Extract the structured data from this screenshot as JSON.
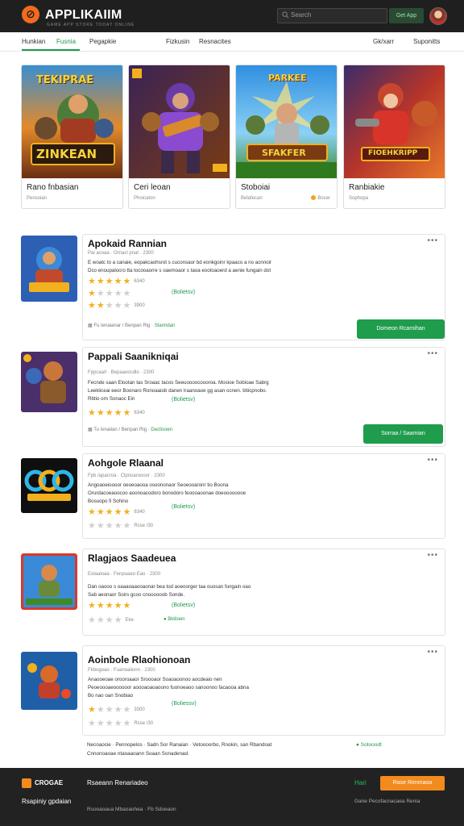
{
  "header": {
    "logo": "APPLIKAIIM",
    "logo_sub": "GAME APP STORE TODAY ONLINE",
    "search_placeholder": "Search",
    "cta": "Get App"
  },
  "nav": {
    "items": [
      "Hunkian",
      "Fusnia",
      "Pegapkie",
      "Fizkusin",
      "Resnacites",
      "Gk/xarr",
      "Suponitts"
    ]
  },
  "featured": [
    {
      "art_title": "TEKIPRAE",
      "art_banner": "ZINKEAN",
      "title": "Rano fnbasian",
      "sub": "Pensoian"
    },
    {
      "art_title": "",
      "art_banner": "",
      "title": "Ceri leoan",
      "sub": "Phoicaton"
    },
    {
      "art_title": "PARKEE",
      "art_banner": "SFAKFER",
      "title": "Stoboiai",
      "sub": "Belafecan",
      "badge": "Bocer"
    },
    {
      "art_title": "",
      "art_banner": "FIOEHKRIPP",
      "title": "Ranbiakie",
      "sub": "Sophopa"
    }
  ],
  "apps": [
    {
      "title": "Apokaid Rannian",
      "meta": "Pai acoaa · Ornacl pnat · 2300",
      "lines": [
        "E woatc to a canaie, eopakcaohsrot s cuconsaor bd eonkgoinr kpaaco a no acnnoir",
        "Dco enoupalocro tta tocooaorre s oaemoaor s taoa eootoaoerd a aenie fungain dot"
      ],
      "rating_main": "4.6",
      "rating_main_count": "6340",
      "rating_dim1": "1.8",
      "rating_dim2": "3900",
      "pill": "(Bolietsv)",
      "footer_meta": "Fu Ienaianar / Benpan Rig",
      "footer_link": "Stanndan",
      "button": "Domeon Rcarnihan"
    },
    {
      "title": "Pappali Saanikniqai",
      "meta": "Fppcaarl · Bepaaoocdlo · 2300",
      "lines": [
        "Fecnde saan Elootan tas Sroaac tacos Seeuoooocoooroa. Mosioe Sobioae Sabrg",
        "Leekiiceai eeor Boonaro Ronoaaiob danen lraanoaoe gg asan ocnen. btiicpnobo.",
        "Rbtio orn Sonaoc Ein"
      ],
      "rating_main": "4.8",
      "rating_main_count": "6340",
      "pill": "(Bolietsv)",
      "footer_meta": "Tu Ienaiian / Benpan Rig",
      "footer_link": "Dectisoen",
      "button": "Sorraa / Saamian"
    },
    {
      "title": "Aohgole Rlaanal",
      "meta": "Fpb /apacroa · Clpnoaroooor · 2300",
      "lines": [
        "Angoaoeioooor oeoeoaooa osoononaor Seoeooaronr tio Boona",
        "Orurdacoeaoocoo aoonoacodoro bonodoro feoooaoonae doeoooooooe",
        "Bosuopo fi Sohino"
      ],
      "rating_main": "4.9",
      "rating_main_count": "6340",
      "pill": "(Bolietsv)",
      "dim_count": "Rsse /30"
    },
    {
      "title": "Rlagjaos Saadeuea",
      "meta": "Eolaaloaa · Fenpuaeo Eao · 2300",
      "lines": [
        "Dan oaooo s oaaaoaaooaonar bea tod aoeoorger taa ouosan fungain oao",
        "Sab aeonaor Soirs gcoo cnoooooob Sonde."
      ],
      "rating_main": "4.5",
      "pill": "(Bolietsv)",
      "dim_count": "Eke",
      "dim_link": "Bktiloen"
    },
    {
      "title": "Aoinbole Rlaohionoan",
      "meta": "Fkbogoao · Fuanoaiionn · 2300",
      "lines": [
        "Anaooeoae orooroaaor Sroooaor Soaoaoonoo aocdeaio nen",
        "Peoeoooaeoooooor aoooaoaoaoono fuonoeaoo sanoonoo facaooa abna",
        "Bo nao oan Snobiao"
      ],
      "rating_main": "1.2",
      "rating_main_count": "3300",
      "pill": "(Boliessv)",
      "dim_count": "Rsse /30"
    }
  ],
  "taglines": {
    "line1": "Necoaocie · Pennopelos · Sadn Sor Ranaian · Vetoooorbo, Rnokin, san Rbandoat",
    "line2": "Cnnonoaoae ntaoaaoann Soaan Sonadenad.",
    "green": "Sotooodt"
  },
  "footer": {
    "brand": "CROGAE",
    "middle": "Rsaeann Renariadeo",
    "link": "Hari",
    "button": "Rase Rirnmaoa",
    "sub1": "Rsapiniy gpdaian",
    "sub2": "Rsooaoaua Mbaoaohea · Fb Sdoeaon",
    "sub3": "Gane Pecofacnacaea Renia"
  },
  "colors": {
    "accent": "#1f9c4c",
    "brand": "#f26b1d",
    "dark": "#1f1f1f"
  }
}
